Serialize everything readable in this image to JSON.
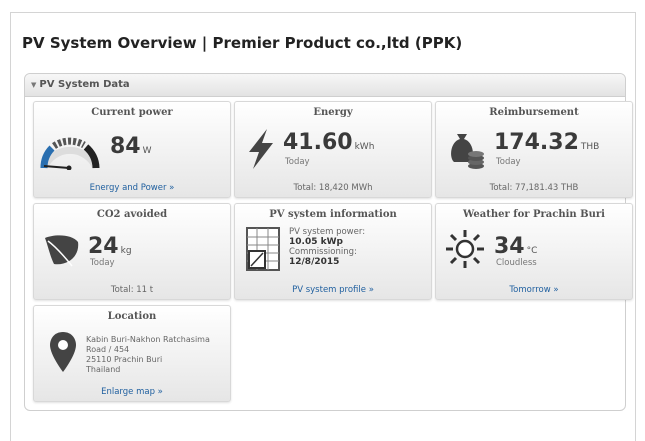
{
  "page": {
    "title": "PV System Overview | Premier Product co.,ltd (PPK)"
  },
  "panel": {
    "toggle_icon": "collapse-triangle",
    "header": "PV System Data"
  },
  "tiles": {
    "current_power": {
      "title": "Current power",
      "value": "84",
      "unit": "W",
      "footer": "Energy and Power »",
      "icon": "gauge-icon"
    },
    "energy": {
      "title": "Energy",
      "value": "41.60",
      "unit": "kWh",
      "period": "Today",
      "footer": "Total: 18,420 MWh",
      "icon": "lightning-icon"
    },
    "reimbursement": {
      "title": "Reimbursement",
      "value": "174.32",
      "unit": "THB",
      "period": "Today",
      "footer": "Total: 77,181.43 THB",
      "icon": "money-bag-icon"
    },
    "co2": {
      "title": "CO2 avoided",
      "value": "24",
      "unit": "kg",
      "period": "Today",
      "footer": "Total: 11 t",
      "icon": "leaf-icon"
    },
    "pv_info": {
      "title": "PV system information",
      "power_label": "PV system power:",
      "power_value": "10.05 kWp",
      "commission_label": "Commissioning:",
      "commission_value": "12/8/2015",
      "footer": "PV system profile »",
      "icon": "solar-panel-icon"
    },
    "weather": {
      "title": "Weather for Prachin Buri",
      "value": "34",
      "unit": "°C",
      "condition": "Cloudless",
      "footer": "Tomorrow »",
      "icon": "sun-icon"
    },
    "location": {
      "title": "Location",
      "lines": [
        "Kabin Buri-Nakhon Ratchasima",
        "Road / 454",
        "25110 Prachin Buri",
        "Thailand"
      ],
      "footer": "Enlarge map »",
      "icon": "map-pin-icon"
    }
  },
  "colors": {
    "icon": "#4a4a4a",
    "link": "#1f5f9f",
    "accent_blue": "#2a6fb0"
  }
}
